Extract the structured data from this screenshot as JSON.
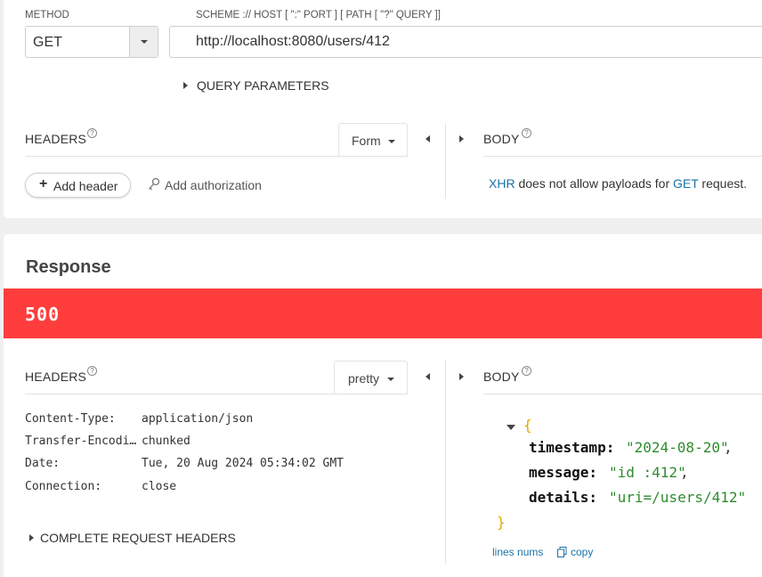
{
  "request": {
    "method_label": "METHOD",
    "method_value": "GET",
    "url_label": "SCHEME :// HOST [ \":\" PORT ] [ PATH [ \"?\" QUERY ]]",
    "url_value": "http://localhost:8080/users/412",
    "query_params_label": "QUERY PARAMETERS",
    "headers_title": "HEADERS",
    "help_glyph": "?",
    "headers_mode": "Form",
    "add_header_label": "Add header",
    "add_auth_label": "Add authorization",
    "body_title": "BODY",
    "body_msg": {
      "xhr": "XHR",
      "middle": " does not allow payloads for ",
      "method": "GET",
      "end": " request."
    }
  },
  "response": {
    "title": "Response",
    "status_code": "500",
    "status_color": "#ff3d3d",
    "headers_title": "HEADERS",
    "headers_mode": "pretty",
    "headers": [
      {
        "name": "Content-Type:",
        "value": "application/json"
      },
      {
        "name": "Transfer-Encodi…",
        "value": "chunked"
      },
      {
        "name": "Date:",
        "value": "Tue, 20 Aug 2024 05:34:02 GMT"
      },
      {
        "name": "Connection:",
        "value": "close"
      }
    ],
    "complete_headers_label": "COMPLETE REQUEST HEADERS",
    "body_title": "BODY",
    "json": {
      "open": "{",
      "close": "}",
      "entries": [
        {
          "key": "timestamp:",
          "value": "\"2024-08-20\"",
          "sep": ","
        },
        {
          "key": "message:",
          "value": "\"id :412\"",
          "sep": ","
        },
        {
          "key": "details:",
          "value": "\"uri=/users/412\"",
          "sep": ""
        }
      ]
    },
    "lines_nums_label": "lines nums",
    "copy_label": "copy"
  },
  "icons": {
    "plus": "plus-icon",
    "key": "key-icon",
    "copy": "copy-icon"
  },
  "colors": {
    "accent": "#1a73a8",
    "error": "#ff3d3d",
    "json_string": "#2e8b2e",
    "json_brace": "#e0a800"
  }
}
